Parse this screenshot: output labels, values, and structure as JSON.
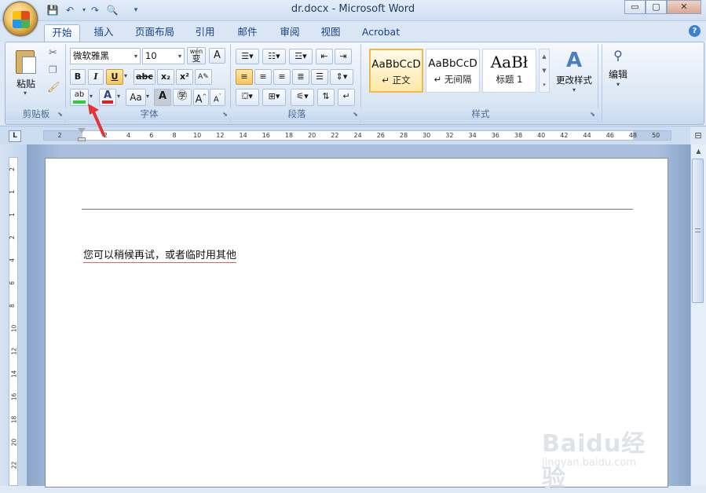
{
  "window": {
    "title": "dr.docx - Microsoft Word",
    "minimize": "▭",
    "restore": "▢",
    "close": "✕"
  },
  "tabs": [
    "开始",
    "插入",
    "页面布局",
    "引用",
    "邮件",
    "审阅",
    "视图",
    "Acrobat"
  ],
  "help": "?",
  "clipboard": {
    "paste_label": "粘贴",
    "group_label": "剪贴板"
  },
  "font": {
    "font_name": "微软雅黑",
    "font_size": "10",
    "bold": "B",
    "italic": "I",
    "underline": "U",
    "strike": "abc",
    "subscript": "x₂",
    "superscript": "x²",
    "highlight": "ab",
    "font_color": "A",
    "change_case": "Aa",
    "grow": "A",
    "shrink": "A",
    "group_label": "字体",
    "wen": "wén",
    "phonetic_char": "变"
  },
  "paragraph": {
    "group_label": "段落"
  },
  "styles": {
    "cards": [
      {
        "sample": "AaBbCcD",
        "name": "↵ 正文"
      },
      {
        "sample": "AaBbCcD",
        "name": "↵ 无间隔"
      },
      {
        "sample": "AaBł",
        "name": "标题 1"
      }
    ],
    "change_styles": "更改样式",
    "group_label": "样式"
  },
  "editing": {
    "label": "编辑"
  },
  "ruler": {
    "numbers": [
      "2",
      "",
      "2",
      "4",
      "6",
      "8",
      "10",
      "12",
      "14",
      "16",
      "18",
      "20",
      "22",
      "24",
      "26",
      "28",
      "30",
      "32",
      "34",
      "36",
      "38",
      "40",
      "42",
      "44",
      "46",
      "48",
      "50"
    ],
    "vnumbers": [
      "2",
      "1",
      "1",
      "2",
      "4",
      "6",
      "8",
      "10",
      "12",
      "14",
      "16",
      "18",
      "20",
      "22"
    ]
  },
  "document": {
    "text": "您可以稍候再试，或者临时用其他"
  },
  "watermark": {
    "main": "Baidu经验",
    "sub": "jingyan.baidu.com"
  },
  "colors": {
    "highlight_bar": "#33cc33",
    "font_color_bar": "#e02020",
    "arrow": "#e53333"
  }
}
